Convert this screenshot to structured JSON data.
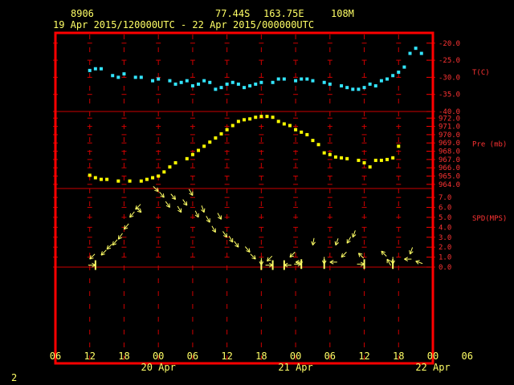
{
  "header": {
    "station": "8906",
    "lat": "77.44S",
    "lon": "163.75E",
    "elev": "108M",
    "period": "19 Apr 2015/120000UTC - 22 Apr 2015/000000UTC"
  },
  "footer": {
    "page_number": "2"
  },
  "colors": {
    "frame": "#ff0000",
    "grid": "#cc0000",
    "text": "#ffff66",
    "temperature": "#33e5ff",
    "pressure": "#ffff00",
    "wind": "#ffff66"
  },
  "chart_data": {
    "type": "scatter",
    "x_unit": "hours since 19 Apr 2015 06 UTC",
    "x_range": [
      0,
      66
    ],
    "x_tick_hours": [
      0,
      6,
      12,
      18,
      24,
      30,
      36,
      42,
      48,
      54,
      60,
      66
    ],
    "x_tick_labels": [
      "06",
      "12",
      "18",
      "00",
      "06",
      "12",
      "18",
      "00",
      "06",
      "12",
      "18",
      "00",
      "06"
    ],
    "day_labels": [
      {
        "hour": 18,
        "label": "20 Apr"
      },
      {
        "hour": 42,
        "label": "21 Apr"
      },
      {
        "hour": 66,
        "label": "22 Apr"
      }
    ],
    "panels": [
      {
        "name": "T(C)",
        "ylim": [
          -40,
          -17
        ],
        "tick_labels": [
          "-20.0",
          "-25.0",
          "-30.0",
          "-35.0",
          "-40.0"
        ],
        "tick_values": [
          -20,
          -25,
          -30,
          -35,
          -40
        ],
        "points": [
          [
            6,
            -28
          ],
          [
            7,
            -27.5
          ],
          [
            8,
            -27.5
          ],
          [
            10,
            -29.5
          ],
          [
            11,
            -30
          ],
          [
            12,
            -29
          ],
          [
            14,
            -30
          ],
          [
            15,
            -30
          ],
          [
            17,
            -31
          ],
          [
            18,
            -30.5
          ],
          [
            20,
            -31
          ],
          [
            21,
            -32
          ],
          [
            22,
            -31.5
          ],
          [
            23,
            -31
          ],
          [
            24,
            -32.5
          ],
          [
            25,
            -32
          ],
          [
            26,
            -31
          ],
          [
            27,
            -31.5
          ],
          [
            28,
            -33.5
          ],
          [
            29,
            -33
          ],
          [
            30,
            -32
          ],
          [
            31,
            -31.5
          ],
          [
            32,
            -32
          ],
          [
            33,
            -33
          ],
          [
            34,
            -32.5
          ],
          [
            35,
            -32
          ],
          [
            36,
            -31.5
          ],
          [
            38,
            -31.5
          ],
          [
            39,
            -30.5
          ],
          [
            40,
            -30.5
          ],
          [
            42,
            -31
          ],
          [
            43,
            -30.5
          ],
          [
            44,
            -30.5
          ],
          [
            45,
            -31
          ],
          [
            47,
            -31.5
          ],
          [
            48,
            -32
          ],
          [
            50,
            -32.5
          ],
          [
            51,
            -33
          ],
          [
            52,
            -33.5
          ],
          [
            53,
            -33.5
          ],
          [
            54,
            -33
          ],
          [
            55,
            -32
          ],
          [
            56,
            -32.5
          ],
          [
            57,
            -31
          ],
          [
            58,
            -30.5
          ],
          [
            59,
            -29.5
          ],
          [
            60,
            -28.5
          ],
          [
            61,
            -27
          ],
          [
            62,
            -23
          ],
          [
            63,
            -21.5
          ],
          [
            64,
            -23
          ]
        ]
      },
      {
        "name": "Pre (mb)",
        "ylim": [
          963.5,
          972.8
        ],
        "tick_labels": [
          "972.0",
          "971.0",
          "970.0",
          "969.0",
          "968.0",
          "967.0",
          "966.0",
          "965.0",
          "964.0"
        ],
        "tick_values": [
          972,
          971,
          970,
          969,
          968,
          967,
          966,
          965,
          964
        ],
        "points": [
          [
            6,
            965.1
          ],
          [
            7,
            964.8
          ],
          [
            8,
            964.6
          ],
          [
            9,
            964.6
          ],
          [
            11,
            964.4
          ],
          [
            13,
            964.4
          ],
          [
            15,
            964.4
          ],
          [
            16,
            964.6
          ],
          [
            17,
            964.8
          ],
          [
            18,
            965.0
          ],
          [
            19,
            965.5
          ],
          [
            20,
            966.1
          ],
          [
            21,
            966.6
          ],
          [
            23,
            967.1
          ],
          [
            24,
            967.6
          ],
          [
            25,
            968.1
          ],
          [
            26,
            968.6
          ],
          [
            27,
            969.1
          ],
          [
            28,
            969.6
          ],
          [
            29,
            970.1
          ],
          [
            30,
            970.6
          ],
          [
            31,
            971.1
          ],
          [
            32,
            971.6
          ],
          [
            33,
            971.8
          ],
          [
            34,
            971.9
          ],
          [
            35,
            972.1
          ],
          [
            36,
            972.2
          ],
          [
            37,
            972.2
          ],
          [
            38,
            972.1
          ],
          [
            39,
            971.6
          ],
          [
            40,
            971.3
          ],
          [
            41,
            971.1
          ],
          [
            42,
            970.6
          ],
          [
            43,
            970.3
          ],
          [
            44,
            970.0
          ],
          [
            45,
            969.3
          ],
          [
            46,
            968.8
          ],
          [
            47,
            967.8
          ],
          [
            48,
            967.6
          ],
          [
            49,
            967.3
          ],
          [
            50,
            967.2
          ],
          [
            51,
            967.1
          ],
          [
            53,
            966.9
          ],
          [
            54,
            966.6
          ],
          [
            55,
            966.1
          ],
          [
            56,
            966.9
          ],
          [
            57,
            966.9
          ],
          [
            58,
            967.0
          ],
          [
            59,
            967.2
          ],
          [
            60,
            968.6
          ]
        ]
      },
      {
        "name": "SPD(MPS)",
        "ylim": [
          0,
          7.9
        ],
        "tick_labels": [
          "7.0",
          "6.0",
          "5.0",
          "4.0",
          "3.0",
          "2.0",
          "1.0",
          "0.0"
        ],
        "tick_values": [
          7,
          6,
          5,
          4,
          3,
          2,
          1,
          0
        ],
        "wind": [
          [
            6,
            0.8,
            45
          ],
          [
            7,
            0.2,
            270
          ],
          [
            8,
            1.2,
            45
          ],
          [
            9,
            1.8,
            45
          ],
          [
            10,
            2.2,
            40
          ],
          [
            11,
            2.8,
            35
          ],
          [
            12,
            3.8,
            40
          ],
          [
            13,
            5.0,
            40
          ],
          [
            14,
            5.8,
            45
          ],
          [
            15,
            5.5,
            315
          ],
          [
            18,
            7.6,
            315
          ],
          [
            19,
            7.0,
            320
          ],
          [
            20,
            6.0,
            325
          ],
          [
            21,
            6.8,
            320
          ],
          [
            22,
            5.5,
            330
          ],
          [
            23,
            6.2,
            325
          ],
          [
            24,
            7.2,
            330
          ],
          [
            25,
            5.0,
            335
          ],
          [
            26,
            5.5,
            340
          ],
          [
            27,
            4.5,
            330
          ],
          [
            28,
            3.5,
            330
          ],
          [
            29,
            4.8,
            330
          ],
          [
            30,
            3.0,
            325
          ],
          [
            31,
            2.5,
            330
          ],
          [
            32,
            2.0,
            325
          ],
          [
            34,
            1.5,
            320
          ],
          [
            35,
            0.8,
            315
          ],
          [
            36,
            0.2,
            0
          ],
          [
            37,
            0.6,
            45
          ],
          [
            38,
            0.2,
            270
          ],
          [
            40,
            0.2,
            90
          ],
          [
            41,
            1.0,
            45
          ],
          [
            42,
            0.5,
            90
          ],
          [
            43,
            0.3,
            270
          ],
          [
            45,
            2.2,
            10
          ],
          [
            47,
            0.3,
            0
          ],
          [
            48,
            0.5,
            90
          ],
          [
            49,
            2.2,
            20
          ],
          [
            50,
            1.0,
            45
          ],
          [
            51,
            2.4,
            30
          ],
          [
            52,
            3.0,
            20
          ],
          [
            53,
            1.4,
            135
          ],
          [
            54,
            0.3,
            270
          ],
          [
            57,
            1.6,
            135
          ],
          [
            58,
            0.8,
            150
          ],
          [
            59,
            0.3,
            0
          ],
          [
            61,
            0.8,
            90
          ],
          [
            62,
            1.3,
            20
          ],
          [
            63,
            0.6,
            110
          ]
        ]
      }
    ]
  }
}
